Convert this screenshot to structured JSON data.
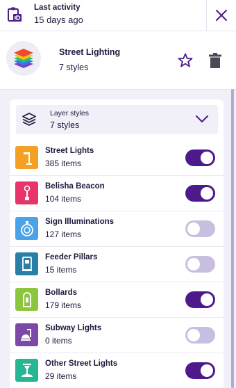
{
  "topbar": {
    "activity_title": "Last activity",
    "activity_value": "15 days ago",
    "left_icon": "clipboard-id-icon",
    "close_icon": "close-icon"
  },
  "header": {
    "title": "Street Lighting",
    "subtitle": "7 styles",
    "logo_icon": "layers-stack-icon",
    "favorite_icon": "star-outline-icon",
    "delete_icon": "trash-icon"
  },
  "styles_select": {
    "label": "Layer styles",
    "value": "7 styles",
    "icon": "layers-icon",
    "chevron_icon": "chevron-down-icon"
  },
  "colors": {
    "accent": "#4d1a8c",
    "toggle_off": "#c8bfe0",
    "background": "#f1eff8"
  },
  "layers": [
    {
      "name": "Street Lights",
      "count": "385 items",
      "enabled": true,
      "icon": "street-light-icon",
      "color": "#f4a024"
    },
    {
      "name": "Belisha Beacon",
      "count": "104 items",
      "enabled": true,
      "icon": "belisha-beacon-icon",
      "color": "#e8336b"
    },
    {
      "name": "Sign Illuminations",
      "count": "127 items",
      "enabled": false,
      "icon": "sign-illumination-icon",
      "color": "#4aa3e6"
    },
    {
      "name": "Feeder Pillars",
      "count": "15 items",
      "enabled": false,
      "icon": "feeder-pillar-icon",
      "color": "#2a7fa6"
    },
    {
      "name": "Bollards",
      "count": "179 items",
      "enabled": true,
      "icon": "bollard-icon",
      "color": "#8cc63f"
    },
    {
      "name": "Subway Lights",
      "count": "0 items",
      "enabled": false,
      "icon": "subway-light-icon",
      "color": "#7b4aa8"
    },
    {
      "name": "Other Street Lights",
      "count": "29 items",
      "enabled": true,
      "icon": "other-street-light-icon",
      "color": "#25b694"
    }
  ]
}
